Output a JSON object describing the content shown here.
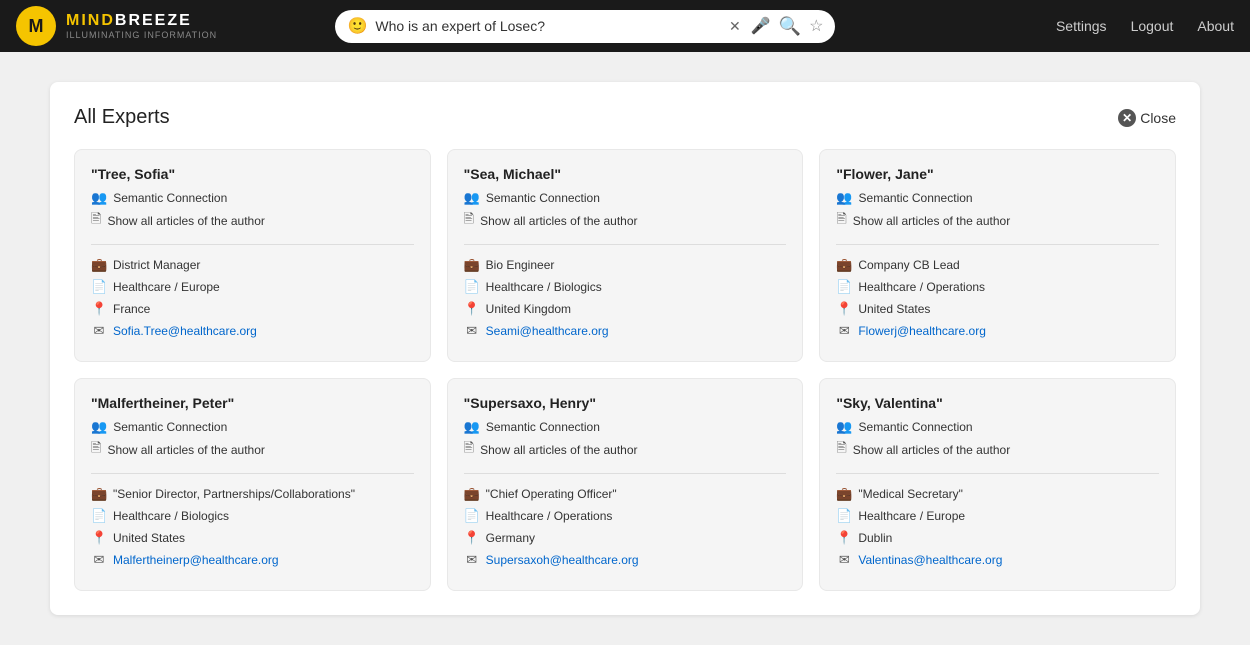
{
  "header": {
    "logo_letter": "M",
    "logo_name_part1": "MIND",
    "logo_name_part2": "BREEZE",
    "logo_tagline": "ILLUMINATING INFORMATION",
    "search_placeholder": "Who is an expert of Losec?",
    "search_value": "Who is an expert of Losec?",
    "nav": [
      {
        "label": "Settings",
        "id": "settings"
      },
      {
        "label": "Logout",
        "id": "logout"
      },
      {
        "label": "About",
        "id": "about"
      }
    ]
  },
  "page": {
    "title": "All Experts",
    "close_label": "Close"
  },
  "experts": [
    {
      "id": "tree-sofia",
      "name": "\"Tree, Sofia\"",
      "connection": "Semantic Connection",
      "articles": "Show all articles of the author",
      "role": "District Manager",
      "division": "Healthcare / Europe",
      "location": "France",
      "email": "Sofia.Tree@healthcare.org"
    },
    {
      "id": "sea-michael",
      "name": "\"Sea, Michael\"",
      "connection": "Semantic Connection",
      "articles": "Show all articles of the author",
      "role": "Bio Engineer",
      "division": "Healthcare / Biologics",
      "location": "United Kingdom",
      "email": "Seami@healthcare.org"
    },
    {
      "id": "flower-jane",
      "name": "\"Flower, Jane\"",
      "connection": "Semantic Connection",
      "articles": "Show all articles of the author",
      "role": "Company CB Lead",
      "division": "Healthcare / Operations",
      "location": "United States",
      "email": "Flowerj@healthcare.org"
    },
    {
      "id": "malfertheiner-peter",
      "name": "\"Malfertheiner, Peter\"",
      "connection": "Semantic Connection",
      "articles": "Show all articles of the author",
      "role": "\"Senior Director, Partnerships/Collaborations\"",
      "division": "Healthcare / Biologics",
      "location": "United States",
      "email": "Malfertheinerp@healthcare.org"
    },
    {
      "id": "supersaxo-henry",
      "name": "\"Supersaxo, Henry\"",
      "connection": "Semantic Connection",
      "articles": "Show all articles of the author",
      "role": "\"Chief Operating Officer\"",
      "division": "Healthcare / Operations",
      "location": "Germany",
      "email": "Supersaxoh@healthcare.org"
    },
    {
      "id": "sky-valentina",
      "name": "\"Sky, Valentina\"",
      "connection": "Semantic Connection",
      "articles": "Show all articles of the author",
      "role": "\"Medical Secretary\"",
      "division": "Healthcare / Europe",
      "location": "Dublin",
      "email": "Valentinas@healthcare.org"
    }
  ]
}
